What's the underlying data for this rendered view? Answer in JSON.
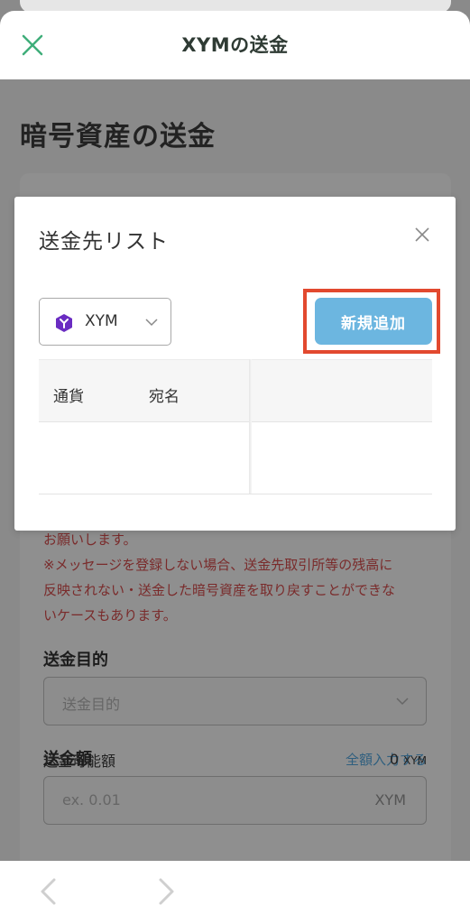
{
  "header": {
    "title": "XYMの送金"
  },
  "page": {
    "title": "暗号資産の送金",
    "warning_line1": "お願いします。",
    "warning_line2": "※メッセージを登録しない場合、送金先取引所等の残高に",
    "warning_line3": "反映されない・送金した暗号資産を取り戻すことができな",
    "warning_line4": "いケースもあります。",
    "purpose_label": "送金目的",
    "purpose_placeholder": "送金目的",
    "amount_label": "送金額",
    "fill_all_link": "全額入力する",
    "amount_placeholder": "ex. 0.01",
    "amount_unit": "XYM",
    "available_label": "送金可能額",
    "available_value": "0",
    "available_unit": "XYM"
  },
  "modal": {
    "title": "送金先リスト",
    "currency": "XYM",
    "add_button": "新規追加",
    "columns": [
      "通貨",
      "宛名"
    ]
  },
  "colors": {
    "accent_green": "#3fae7a",
    "button_blue": "#6cb6e0",
    "highlight_red": "#e2492f"
  }
}
